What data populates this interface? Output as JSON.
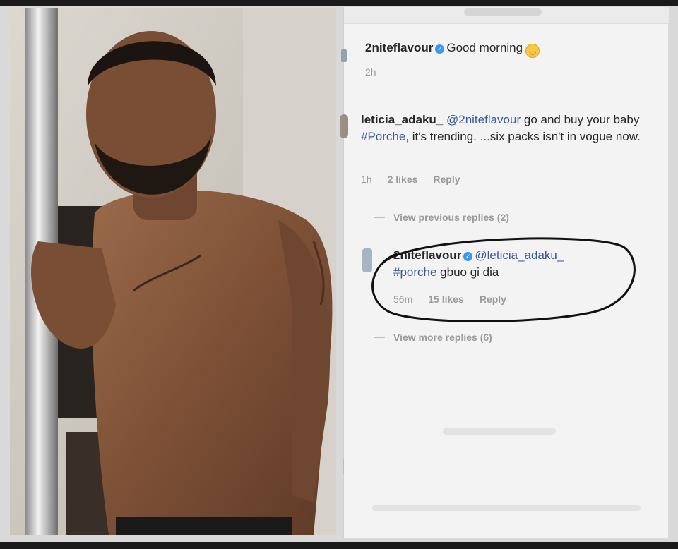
{
  "post_comment": {
    "username": "2niteflavour",
    "verified_icon": "verified-badge-icon",
    "text": "Good morning",
    "emoji": "slightly-smiling-face-emoji",
    "time": "2h"
  },
  "comment": {
    "username": "leticia_adaku_",
    "mention": "@2niteflavour",
    "text_part1": " go and buy your  baby ",
    "hashtag": "#Porche",
    "text_part2": ", it's trending. ...six packs isn't in vogue now.",
    "time": "1h",
    "likes": "2 likes",
    "reply": "Reply"
  },
  "view_previous": "View previous replies (2)",
  "reply_comment": {
    "username": "2niteflavour",
    "verified_icon": "verified-badge-icon",
    "mention": "@leticia_adaku_",
    "hashtag": "#porche",
    "text": " gbuo gi dia",
    "time": "56m",
    "likes": "15 likes",
    "reply": "Reply"
  },
  "view_more": "View more replies (6)",
  "colors": {
    "link": "#385898",
    "text": "#262626",
    "meta": "#9a9a9a",
    "verified": "#3897f0",
    "annotation": "#111111"
  }
}
